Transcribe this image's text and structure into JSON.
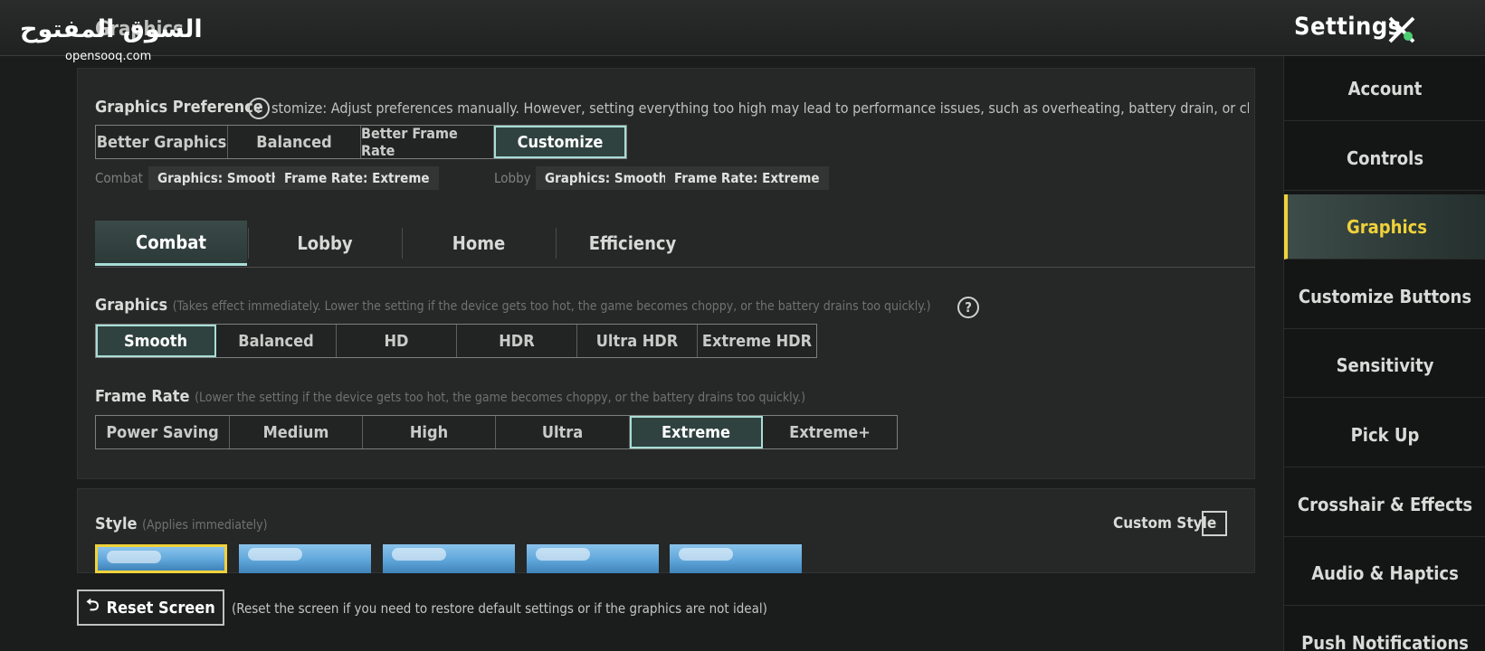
{
  "watermark": {
    "brand": "السوق المفتوح",
    "site": "opensooq.com"
  },
  "header": {
    "page_title": "Graphics",
    "settings_title": "Settings"
  },
  "sidebar": {
    "items": [
      {
        "label": "Account"
      },
      {
        "label": "Controls"
      },
      {
        "label": "Graphics",
        "active": true
      },
      {
        "label": "Customize Buttons"
      },
      {
        "label": "Sensitivity"
      },
      {
        "label": "Pick Up"
      },
      {
        "label": "Crosshair & Effects"
      },
      {
        "label": "Audio & Haptics"
      },
      {
        "label": "Push Notifications"
      }
    ]
  },
  "preference": {
    "label": "Graphics Preference",
    "help": "?",
    "description": "stomize: Adjust preferences manually. However, setting everything too high may lead to performance issues, such as overheating, battery drain, or choppy ge",
    "options": [
      "Better Graphics",
      "Balanced",
      "Better Frame Rate",
      "Customize"
    ],
    "selected": "Customize",
    "combat_label": "Combat",
    "combat_graphics": "Graphics: Smooth",
    "combat_framerate": "Frame Rate: Extreme",
    "lobby_label": "Lobby",
    "lobby_graphics": "Graphics: Smooth",
    "lobby_framerate": "Frame Rate: Extreme"
  },
  "tabs": [
    "Combat",
    "Lobby",
    "Home",
    "Efficiency"
  ],
  "selected_tab": "Combat",
  "graphics": {
    "label": "Graphics",
    "note": "(Takes effect immediately. Lower the setting if the device gets too hot, the game becomes choppy, or the battery drains too quickly.)",
    "help": "?",
    "options": [
      "Smooth",
      "Balanced",
      "HD",
      "HDR",
      "Ultra HDR",
      "Extreme HDR"
    ],
    "selected": "Smooth"
  },
  "frame_rate": {
    "label": "Frame Rate",
    "note": "(Lower the setting if the device gets too hot, the game becomes choppy, or the battery drains too quickly.)",
    "options": [
      "Power Saving",
      "Medium",
      "High",
      "Ultra",
      "Extreme",
      "Extreme+"
    ],
    "selected": "Extreme"
  },
  "style": {
    "label": "Style",
    "note": "(Applies immediately)",
    "thumbnail_count": 5,
    "selected_index": 0,
    "custom_style_label": "Custom Style",
    "custom_style_checked": false
  },
  "reset": {
    "label": "Reset Screen",
    "note": "(Reset the screen if you need to restore default settings or if the graphics are not ideal)"
  },
  "colors": {
    "accent_teal": "#a9ddd6",
    "accent_yellow": "#f0d23a",
    "panel": "#262727"
  }
}
